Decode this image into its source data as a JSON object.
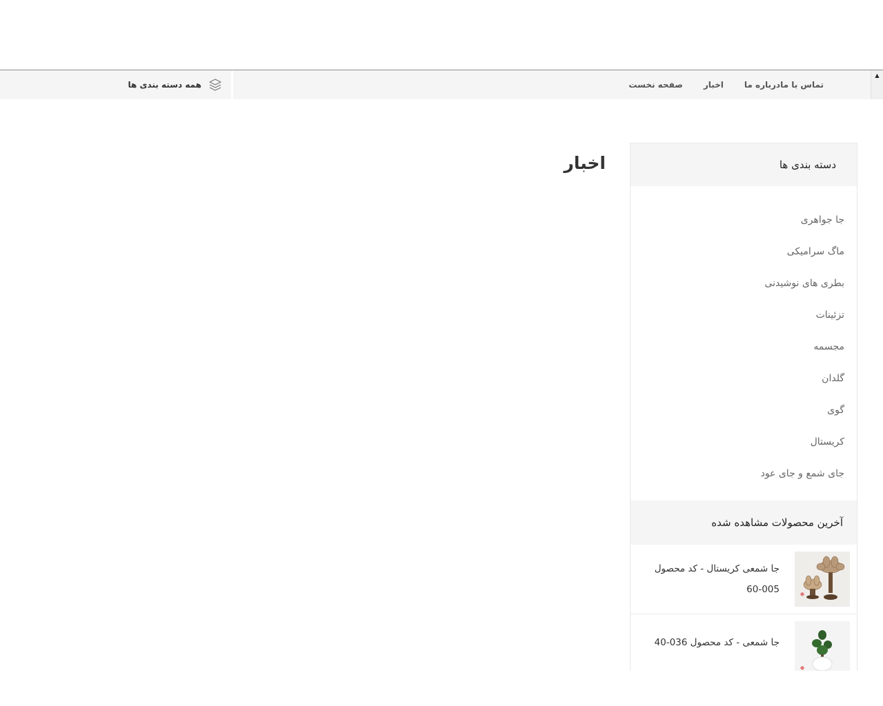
{
  "nav": {
    "items": [
      {
        "label": "صفحه نخست"
      },
      {
        "label": "اخبار"
      },
      {
        "label": "درباره ما"
      },
      {
        "label": "تماس با ما"
      }
    ],
    "scroll_top_icon": "caret-up-icon",
    "all_categories_label": "همه دسته بندی ها",
    "all_categories_icon": "layers-icon"
  },
  "page_title": "اخبار",
  "sidebar": {
    "categories_title": "دسته بندی ها",
    "categories": [
      {
        "label": "جا جواهری"
      },
      {
        "label": "ماگ سرامیکی"
      },
      {
        "label": "بطری های نوشیدنی"
      },
      {
        "label": "تزئینات"
      },
      {
        "label": "مجسمه"
      },
      {
        "label": "گلدان"
      },
      {
        "label": "گوی"
      },
      {
        "label": "کریستال"
      },
      {
        "label": "جای شمع و جای عود"
      }
    ],
    "recent_title": "آخرین محصولات مشاهده شده",
    "recent_products": [
      {
        "name": "جا شمعی کریستال - کد محصول 005-60"
      },
      {
        "name": "جا شمعی - کد محصول 036-40"
      }
    ]
  },
  "colors": {
    "nav_bg": "#f5f5f5",
    "widget_header_bg": "#f5f5f5",
    "text_dark": "#333333",
    "text_muted": "#666666"
  }
}
